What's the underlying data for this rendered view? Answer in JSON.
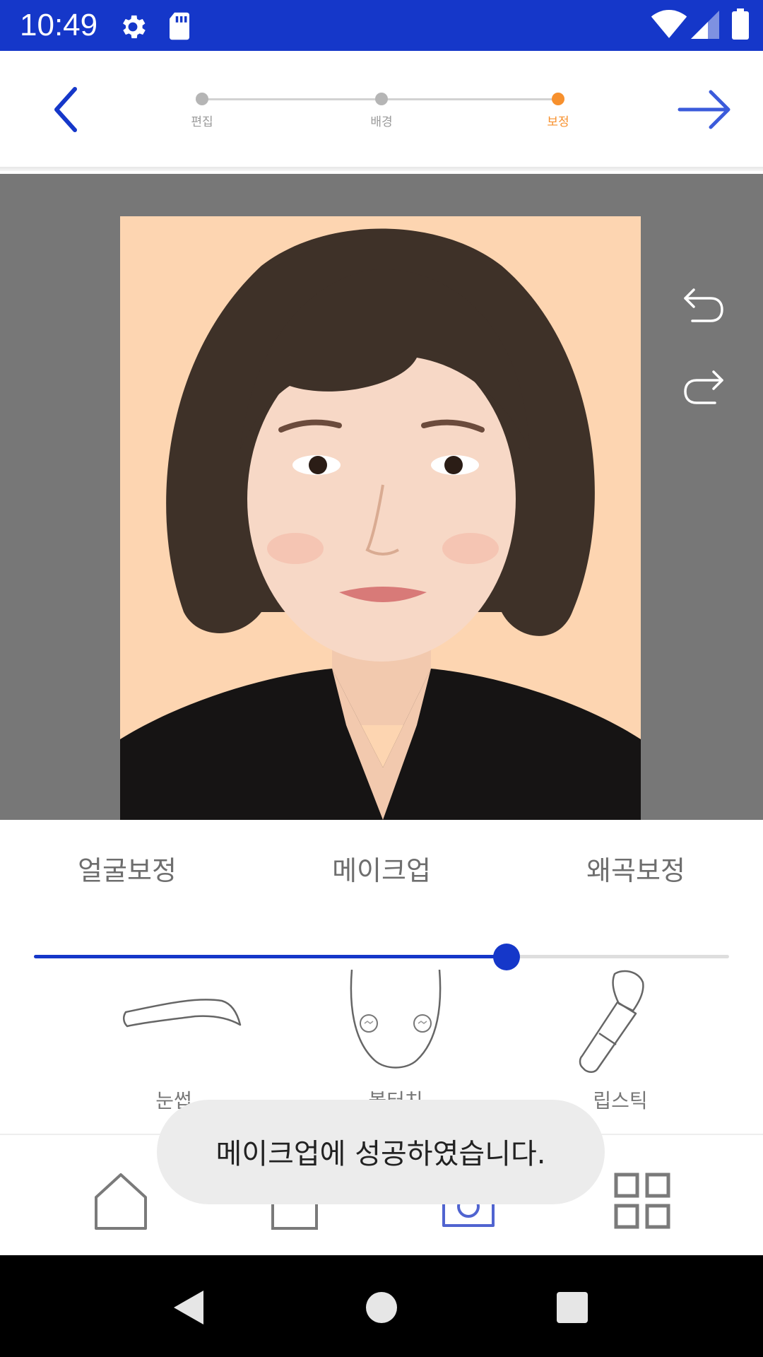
{
  "status_bar": {
    "time": "10:49",
    "icons": [
      "gear-icon",
      "sd-card-icon",
      "wifi-icon",
      "cell-signal-icon",
      "battery-icon"
    ],
    "background": "#1537c9"
  },
  "header": {
    "back_icon": "chevron-left-icon",
    "forward_icon": "arrow-right-icon",
    "steps": [
      {
        "label": "편집",
        "state": "done"
      },
      {
        "label": "배경",
        "state": "done"
      },
      {
        "label": "보정",
        "state": "active"
      }
    ],
    "active_color": "#f7902d"
  },
  "photo": {
    "description_icon": "portrait-photo",
    "background_color": "#fdd5b1",
    "actions": [
      "undo-icon",
      "redo-icon"
    ]
  },
  "tabs": [
    {
      "label": "얼굴보정"
    },
    {
      "label": "메이크업"
    },
    {
      "label": "왜곡보정"
    }
  ],
  "slider": {
    "value": 0.68,
    "accent": "#1537c9"
  },
  "tools": [
    {
      "label": "눈썹",
      "icon": "eyebrow-icon"
    },
    {
      "label": "볼터치",
      "icon": "blush-icon"
    },
    {
      "label": "립스틱",
      "icon": "lipstick-icon"
    }
  ],
  "toast": {
    "message": "메이크업에 성공하였습니다."
  },
  "bottom_nav": {
    "items": [
      "home-icon",
      "calendar-icon",
      "camera-icon",
      "grid-icon"
    ],
    "active": "camera-icon",
    "active_color": "#5064d0"
  },
  "system_nav": {
    "items": [
      "back-triangle-icon",
      "home-circle-icon",
      "recents-square-icon"
    ]
  }
}
